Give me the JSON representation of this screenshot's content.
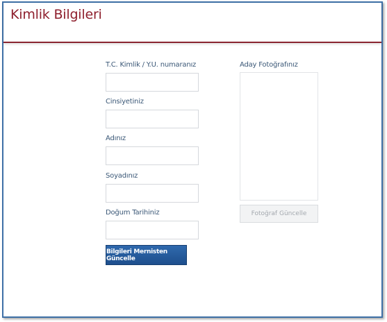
{
  "page": {
    "title": "Kimlik Bilgileri"
  },
  "form": {
    "fields": [
      {
        "label": "T.C. Kimlik / Y.U. numaranız",
        "value": ""
      },
      {
        "label": "Cinsiyetiniz",
        "value": ""
      },
      {
        "label": "Adınız",
        "value": ""
      },
      {
        "label": "Soyadınız",
        "value": ""
      },
      {
        "label": "Doğum Tarihiniz",
        "value": ""
      }
    ],
    "submit_label": "Bilgileri Mernisten Güncelle"
  },
  "photo": {
    "label": "Aday Fotoğrafınız",
    "button_label": "Fotoğraf Güncelle"
  },
  "colors": {
    "title": "#8e1f2d",
    "header_rule": "#8a2530",
    "label": "#3b5877",
    "primary_button": "#2a5fa0",
    "frame_border": "#3d6fa6"
  }
}
